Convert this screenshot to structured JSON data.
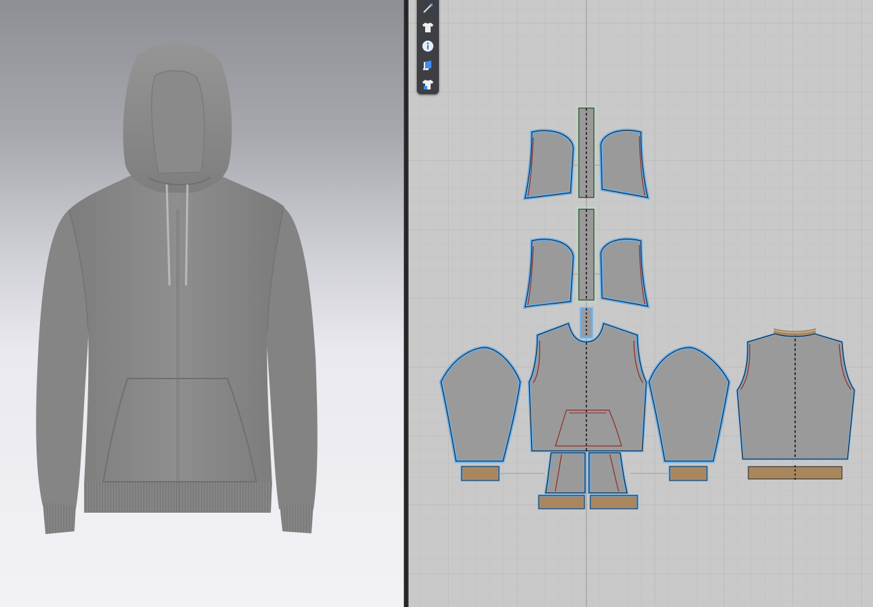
{
  "window": {
    "panels": [
      "3d-garment-view",
      "2d-pattern-view"
    ]
  },
  "toolbar": {
    "tools": [
      {
        "name": "transform-tool",
        "icon": "arrow-pen-icon"
      },
      {
        "name": "garment-view",
        "icon": "tshirt-icon"
      },
      {
        "name": "garment-info",
        "icon": "info-icon"
      },
      {
        "name": "fabric-texture",
        "icon": "fabric-roll-icon"
      },
      {
        "name": "avatar-garment",
        "icon": "tshirt-lock-icon"
      }
    ]
  },
  "colors": {
    "pattern_fill": "#9a9a9a",
    "selection_outline": "#6aaee8",
    "rib_fabric": "#a8875f",
    "seam_line": "#8e2a26",
    "garment_fill": "#8a8a8a",
    "zipper_highlight": "#b8e0c0"
  }
}
